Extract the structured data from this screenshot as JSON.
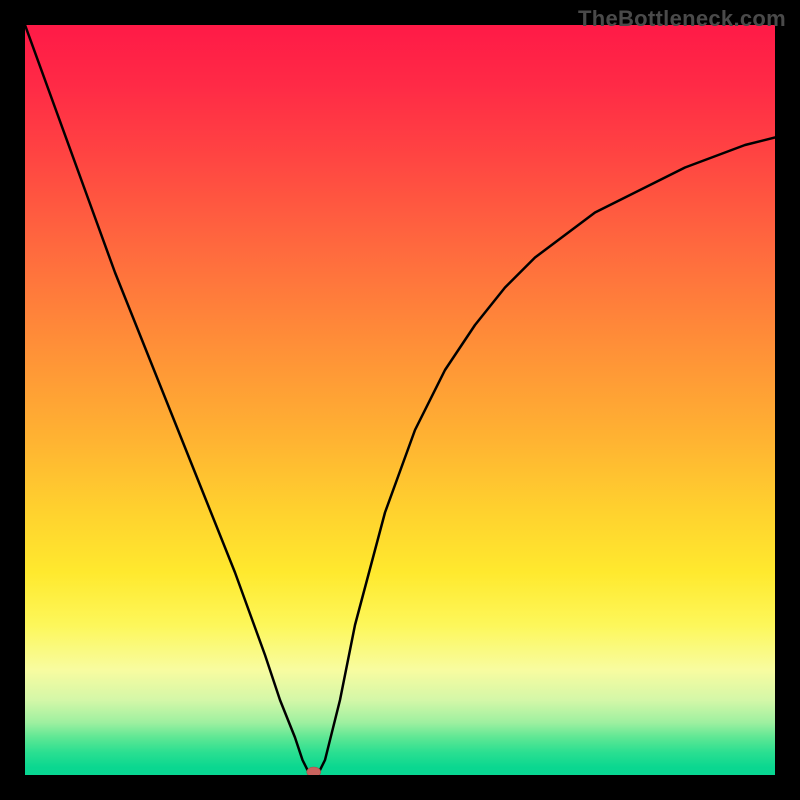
{
  "watermark": "TheBottleneck.com",
  "chart_data": {
    "type": "line",
    "title": "",
    "xlabel": "",
    "ylabel": "",
    "xlim": [
      0,
      100
    ],
    "ylim": [
      0,
      100
    ],
    "series": [
      {
        "name": "bottleneck-curve",
        "x": [
          0,
          4,
          8,
          12,
          16,
          20,
          24,
          28,
          32,
          34,
          36,
          37,
          38,
          39,
          40,
          42,
          44,
          48,
          52,
          56,
          60,
          64,
          68,
          72,
          76,
          80,
          84,
          88,
          92,
          96,
          100
        ],
        "y": [
          100,
          89,
          78,
          67,
          57,
          47,
          37,
          27,
          16,
          10,
          5,
          2,
          0,
          0,
          2,
          10,
          20,
          35,
          46,
          54,
          60,
          65,
          69,
          72,
          75,
          77,
          79,
          81,
          82.5,
          84,
          85
        ]
      }
    ],
    "marker": {
      "x": 38.5,
      "y": 0,
      "color": "#c9635e"
    },
    "gradient_stops": [
      {
        "pos": 0,
        "color": "#ff1a47"
      },
      {
        "pos": 50,
        "color": "#ffb232"
      },
      {
        "pos": 80,
        "color": "#fdf75a"
      },
      {
        "pos": 100,
        "color": "#08d692"
      }
    ]
  }
}
